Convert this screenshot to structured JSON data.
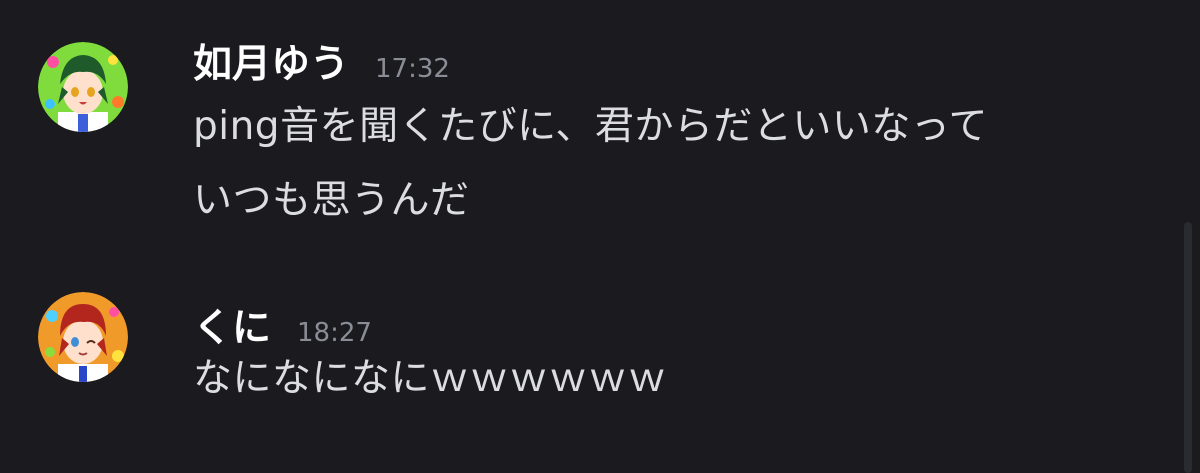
{
  "messages": [
    {
      "author": "如月ゆう",
      "time": "17:32",
      "lines": [
        "ping音を聞くたびに、君からだといいなって",
        "いつも思うんだ"
      ],
      "avatar": {
        "theme": "green-hair",
        "bg": "#7fdc3c",
        "hair": "#1f5a2a",
        "eyes": "#e6a520"
      }
    },
    {
      "author": "くに",
      "time": "18:27",
      "lines": [
        "なになになにｗｗｗｗｗｗ"
      ],
      "avatar": {
        "theme": "red-hair",
        "bg": "#f09a2a",
        "hair": "#b3261e",
        "eyes": "#3f8fd6"
      }
    }
  ]
}
